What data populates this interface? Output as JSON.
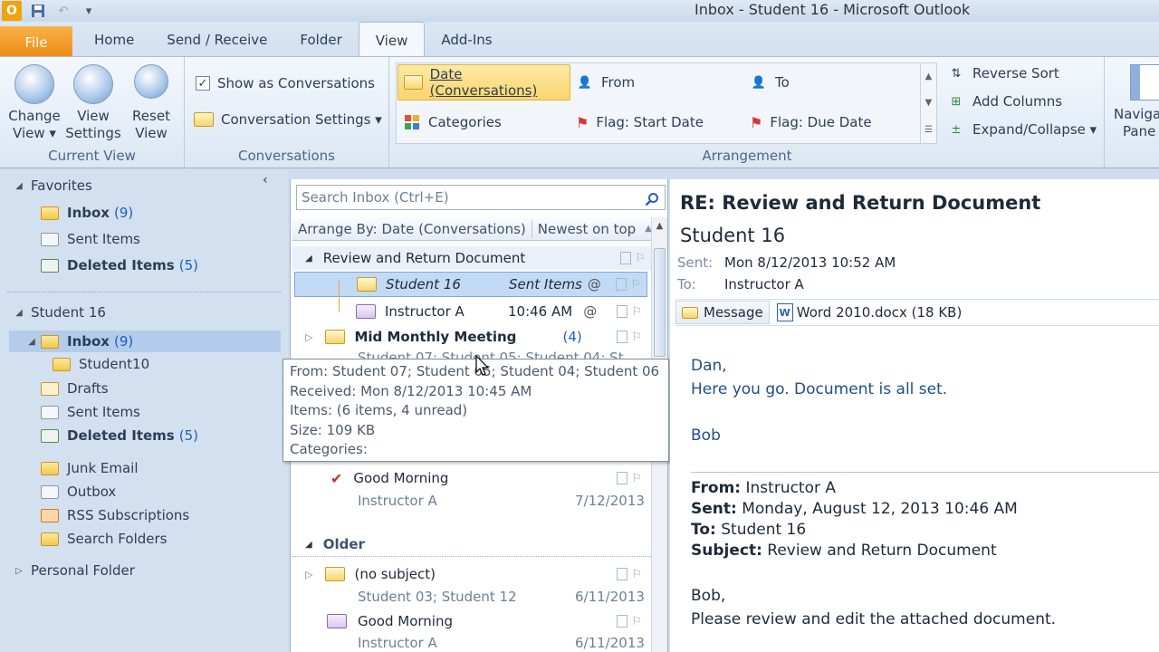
{
  "window": {
    "title": "Inbox - Student 16  -  Microsoft Outlook",
    "app_logo": "O",
    "qat": [
      "save-icon",
      "undo-icon",
      "customize-icon"
    ]
  },
  "tabs": [
    "File",
    "Home",
    "Send / Receive",
    "Folder",
    "View",
    "Add-Ins"
  ],
  "active_tab": "View",
  "ribbon": {
    "current_view": {
      "label": "Current View",
      "change_view": [
        "Change",
        "View ▾"
      ],
      "view_settings": [
        "View",
        "Settings"
      ],
      "reset_view": [
        "Reset",
        "View"
      ]
    },
    "conversations": {
      "label": "Conversations",
      "show_as_conversations": "Show as Conversations",
      "show_as_conversations_checked": true,
      "conversation_settings": "Conversation Settings ▾"
    },
    "arrangement": {
      "label": "Arrangement",
      "items": {
        "date": "Date (Conversations)",
        "from": "From",
        "to": "To",
        "categories": "Categories",
        "flag_start": "Flag: Start Date",
        "flag_due": "Flag: Due Date"
      },
      "reverse_sort": "Reverse Sort",
      "add_columns": "Add Columns",
      "expand_collapse": "Expand/Collapse ▾"
    },
    "navigation": [
      "Naviga",
      "Pane"
    ]
  },
  "folder_pane": {
    "favorites_label": "Favorites",
    "favorites": [
      {
        "name": "Inbox",
        "count": "(9)",
        "bold": true
      },
      {
        "name": "Sent Items",
        "count": "",
        "bold": false
      },
      {
        "name": "Deleted Items",
        "count": "(5)",
        "bold": true
      }
    ],
    "account": "Student 16",
    "folders": [
      {
        "name": "Inbox",
        "count": "(9)",
        "bold": true
      },
      {
        "name": "Student10",
        "count": "",
        "bold": false
      },
      {
        "name": "Drafts",
        "count": "",
        "bold": false
      },
      {
        "name": "Sent Items",
        "count": "",
        "bold": false
      },
      {
        "name": "Deleted Items",
        "count": "(5)",
        "bold": true
      },
      {
        "name": "Junk Email",
        "count": "",
        "bold": false
      },
      {
        "name": "Outbox",
        "count": "",
        "bold": false
      },
      {
        "name": "RSS Subscriptions",
        "count": "",
        "bold": false
      },
      {
        "name": "Search Folders",
        "count": "",
        "bold": false
      }
    ],
    "personal_folder": "Personal Folder"
  },
  "message_list": {
    "search_placeholder": "Search Inbox (Ctrl+E)",
    "arrange_by": "Arrange By: Date (Conversations)",
    "sort_order": "Newest on top",
    "conv1": {
      "subject": "Review and Return Document",
      "items": [
        {
          "from": "Student 16",
          "info": "Sent Items"
        },
        {
          "from": "Instructor A",
          "info": "10:46 AM"
        }
      ]
    },
    "conv2": {
      "subject": "Mid Monthly Meeting",
      "count": "(4)",
      "preview": "Student 07;  Student 05;  Student 04;  St"
    },
    "conv3": {
      "subject": "Good Morning",
      "from": "Instructor A",
      "date": "7/12/2013"
    },
    "older_label": "Older",
    "conv4": {
      "subject": "(no subject)",
      "from": "Student 03;  Student 12",
      "date": "6/11/2013"
    },
    "conv5": {
      "subject": "Good Morning",
      "from": "Instructor A",
      "date": "6/11/2013"
    }
  },
  "tooltip": {
    "from": "From: Student 07;  Student 05;  Student 04;  Student 06",
    "received": "Received: Mon 8/12/2013 10:45 AM",
    "items": "Items:  (6 items, 4 unread)",
    "size": "Size: 109 KB",
    "categories": "Categories:"
  },
  "reading_pane": {
    "subject": "RE: Review and Return Document",
    "sender": "Student 16",
    "sent_label": "Sent:",
    "sent_value": "Mon 8/12/2013 10:52 AM",
    "to_label": "To:",
    "to_value": "Instructor A",
    "message_tab": "Message",
    "attachment": "Word 2010.docx (18 KB)",
    "body": [
      "Dan,",
      "Here you go.  Document is all set.",
      "Bob"
    ],
    "orig_from_label": "From:",
    "orig_from": "Instructor A",
    "orig_sent_label": "Sent:",
    "orig_sent": "Monday, August 12, 2013 10:46 AM",
    "orig_to_label": "To:",
    "orig_to": "Student 16",
    "orig_subject_label": "Subject:",
    "orig_subject": "Review and Return Document",
    "orig_body": [
      "Bob,",
      "Please review and edit the attached document."
    ]
  }
}
